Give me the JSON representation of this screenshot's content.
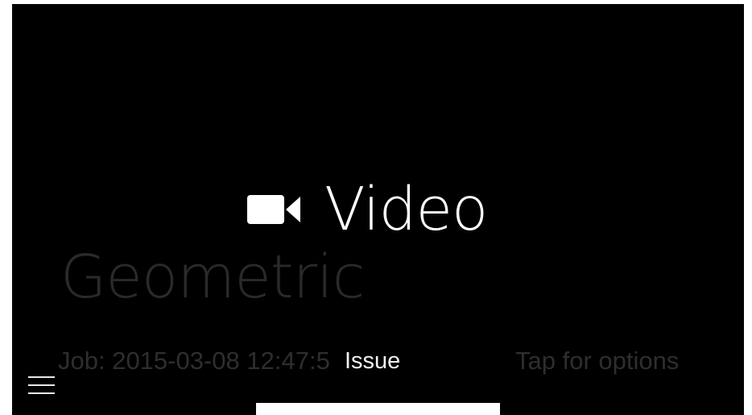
{
  "background": {
    "title": "Geometric",
    "job_label": "Job: 2015-03-08 12:47:5",
    "tap_hint": "Tap for options"
  },
  "overlay": {
    "issue_label": "Issue"
  },
  "menu": {
    "items": [
      {
        "label": "Video",
        "icon": "video-camera-icon"
      }
    ]
  },
  "colors": {
    "screen_bg": "#000000",
    "foreground": "#ffffff",
    "dim_text": "#2e2e2e"
  }
}
